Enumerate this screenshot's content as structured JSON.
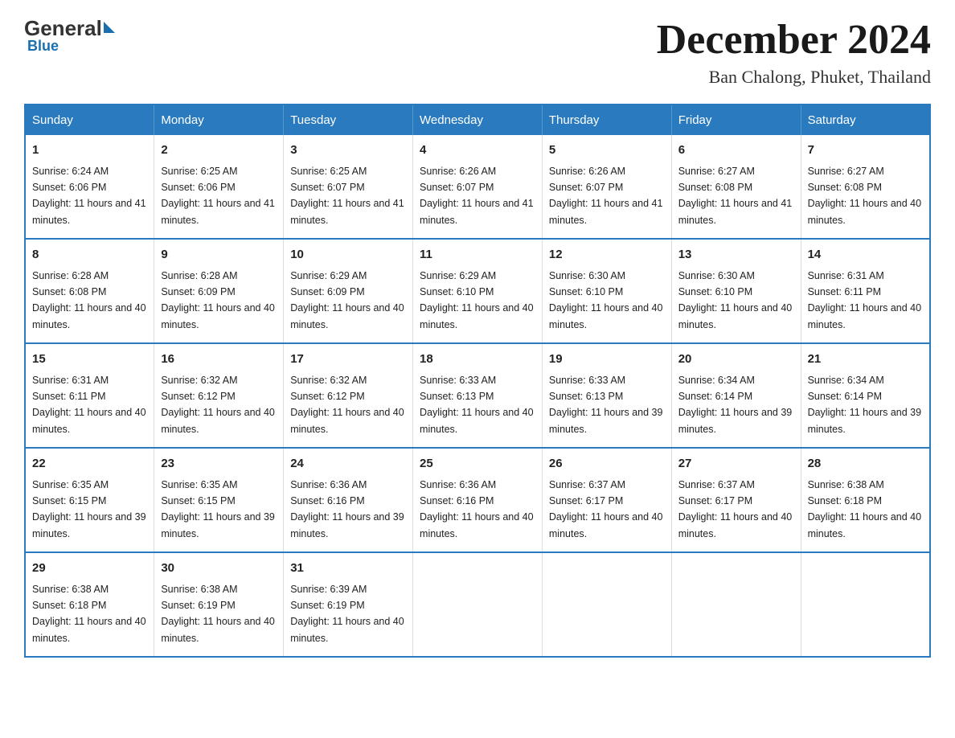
{
  "header": {
    "logo_general": "General",
    "logo_blue": "Blue",
    "month_title": "December 2024",
    "location": "Ban Chalong, Phuket, Thailand"
  },
  "days_of_week": [
    "Sunday",
    "Monday",
    "Tuesday",
    "Wednesday",
    "Thursday",
    "Friday",
    "Saturday"
  ],
  "weeks": [
    [
      {
        "day": "1",
        "sunrise": "6:24 AM",
        "sunset": "6:06 PM",
        "daylight": "11 hours and 41 minutes."
      },
      {
        "day": "2",
        "sunrise": "6:25 AM",
        "sunset": "6:06 PM",
        "daylight": "11 hours and 41 minutes."
      },
      {
        "day": "3",
        "sunrise": "6:25 AM",
        "sunset": "6:07 PM",
        "daylight": "11 hours and 41 minutes."
      },
      {
        "day": "4",
        "sunrise": "6:26 AM",
        "sunset": "6:07 PM",
        "daylight": "11 hours and 41 minutes."
      },
      {
        "day": "5",
        "sunrise": "6:26 AM",
        "sunset": "6:07 PM",
        "daylight": "11 hours and 41 minutes."
      },
      {
        "day": "6",
        "sunrise": "6:27 AM",
        "sunset": "6:08 PM",
        "daylight": "11 hours and 41 minutes."
      },
      {
        "day": "7",
        "sunrise": "6:27 AM",
        "sunset": "6:08 PM",
        "daylight": "11 hours and 40 minutes."
      }
    ],
    [
      {
        "day": "8",
        "sunrise": "6:28 AM",
        "sunset": "6:08 PM",
        "daylight": "11 hours and 40 minutes."
      },
      {
        "day": "9",
        "sunrise": "6:28 AM",
        "sunset": "6:09 PM",
        "daylight": "11 hours and 40 minutes."
      },
      {
        "day": "10",
        "sunrise": "6:29 AM",
        "sunset": "6:09 PM",
        "daylight": "11 hours and 40 minutes."
      },
      {
        "day": "11",
        "sunrise": "6:29 AM",
        "sunset": "6:10 PM",
        "daylight": "11 hours and 40 minutes."
      },
      {
        "day": "12",
        "sunrise": "6:30 AM",
        "sunset": "6:10 PM",
        "daylight": "11 hours and 40 minutes."
      },
      {
        "day": "13",
        "sunrise": "6:30 AM",
        "sunset": "6:10 PM",
        "daylight": "11 hours and 40 minutes."
      },
      {
        "day": "14",
        "sunrise": "6:31 AM",
        "sunset": "6:11 PM",
        "daylight": "11 hours and 40 minutes."
      }
    ],
    [
      {
        "day": "15",
        "sunrise": "6:31 AM",
        "sunset": "6:11 PM",
        "daylight": "11 hours and 40 minutes."
      },
      {
        "day": "16",
        "sunrise": "6:32 AM",
        "sunset": "6:12 PM",
        "daylight": "11 hours and 40 minutes."
      },
      {
        "day": "17",
        "sunrise": "6:32 AM",
        "sunset": "6:12 PM",
        "daylight": "11 hours and 40 minutes."
      },
      {
        "day": "18",
        "sunrise": "6:33 AM",
        "sunset": "6:13 PM",
        "daylight": "11 hours and 40 minutes."
      },
      {
        "day": "19",
        "sunrise": "6:33 AM",
        "sunset": "6:13 PM",
        "daylight": "11 hours and 39 minutes."
      },
      {
        "day": "20",
        "sunrise": "6:34 AM",
        "sunset": "6:14 PM",
        "daylight": "11 hours and 39 minutes."
      },
      {
        "day": "21",
        "sunrise": "6:34 AM",
        "sunset": "6:14 PM",
        "daylight": "11 hours and 39 minutes."
      }
    ],
    [
      {
        "day": "22",
        "sunrise": "6:35 AM",
        "sunset": "6:15 PM",
        "daylight": "11 hours and 39 minutes."
      },
      {
        "day": "23",
        "sunrise": "6:35 AM",
        "sunset": "6:15 PM",
        "daylight": "11 hours and 39 minutes."
      },
      {
        "day": "24",
        "sunrise": "6:36 AM",
        "sunset": "6:16 PM",
        "daylight": "11 hours and 39 minutes."
      },
      {
        "day": "25",
        "sunrise": "6:36 AM",
        "sunset": "6:16 PM",
        "daylight": "11 hours and 40 minutes."
      },
      {
        "day": "26",
        "sunrise": "6:37 AM",
        "sunset": "6:17 PM",
        "daylight": "11 hours and 40 minutes."
      },
      {
        "day": "27",
        "sunrise": "6:37 AM",
        "sunset": "6:17 PM",
        "daylight": "11 hours and 40 minutes."
      },
      {
        "day": "28",
        "sunrise": "6:38 AM",
        "sunset": "6:18 PM",
        "daylight": "11 hours and 40 minutes."
      }
    ],
    [
      {
        "day": "29",
        "sunrise": "6:38 AM",
        "sunset": "6:18 PM",
        "daylight": "11 hours and 40 minutes."
      },
      {
        "day": "30",
        "sunrise": "6:38 AM",
        "sunset": "6:19 PM",
        "daylight": "11 hours and 40 minutes."
      },
      {
        "day": "31",
        "sunrise": "6:39 AM",
        "sunset": "6:19 PM",
        "daylight": "11 hours and 40 minutes."
      },
      null,
      null,
      null,
      null
    ]
  ],
  "labels": {
    "sunrise_prefix": "Sunrise: ",
    "sunset_prefix": "Sunset: ",
    "daylight_prefix": "Daylight: "
  }
}
